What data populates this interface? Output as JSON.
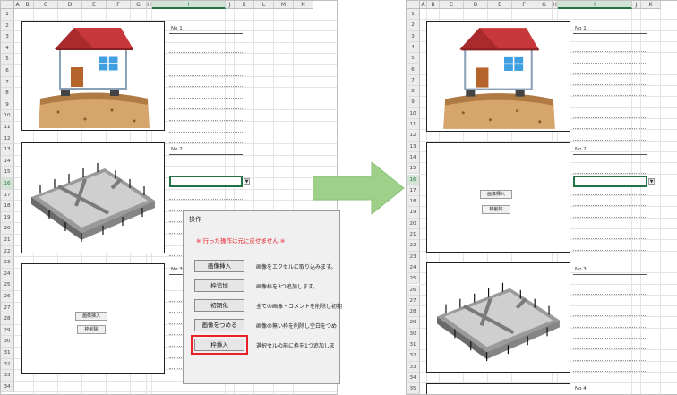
{
  "columns_left": [
    "A",
    "B",
    "C",
    "D",
    "E",
    "F",
    "G",
    "H",
    "I",
    "J",
    "K",
    "L",
    "M",
    "N"
  ],
  "columns_right": [
    "A",
    "B",
    "C",
    "D",
    "E",
    "F",
    "G",
    "H",
    "I",
    "J",
    "K"
  ],
  "rows_left": [
    "1",
    "2",
    "3",
    "4",
    "5",
    "6",
    "7",
    "8",
    "9",
    "10",
    "11",
    "12",
    "13",
    "14",
    "15",
    "16",
    "17",
    "18",
    "19",
    "20",
    "21",
    "22",
    "23",
    "24",
    "25",
    "26",
    "27",
    "28",
    "29",
    "30",
    "31",
    "32",
    "33",
    "34"
  ],
  "rows_right": [
    "1",
    "2",
    "3",
    "4",
    "5",
    "6",
    "7",
    "8",
    "9",
    "10",
    "11",
    "12",
    "13",
    "14",
    "15",
    "16",
    "17",
    "18",
    "19",
    "20",
    "21",
    "22",
    "23",
    "24",
    "25",
    "26",
    "27",
    "28",
    "29",
    "30",
    "31",
    "32",
    "33",
    "34",
    "35"
  ],
  "left": {
    "labels": [
      "No 1",
      "No 2",
      "No 3"
    ],
    "frame3_buttons": [
      "画像挿入",
      "枠削除"
    ]
  },
  "right": {
    "labels": [
      "No 1",
      "No 2",
      "No 3",
      "No 4"
    ],
    "frame2_buttons": [
      "画像挿入",
      "枠削除"
    ]
  },
  "dropdown_symbol": "▼",
  "dialog": {
    "title": "操作",
    "warning": "※ 行った操作は元に戻せません ※",
    "buttons": [
      {
        "label": "画像挿入",
        "desc": "画像をエクセルに取り込みます。"
      },
      {
        "label": "枠追加",
        "desc": "画像枠を3つ追加します。"
      },
      {
        "label": "初期化",
        "desc": "全ての画像・コメントを削除し初期"
      },
      {
        "label": "画像をつめる",
        "desc": "画像の無い枠を削除し空白をつめ"
      },
      {
        "label": "枠挿入",
        "desc": "選択セルの前に枠を1つ追加しま"
      }
    ]
  },
  "colors": {
    "header": "#ececec",
    "selected": "#217346",
    "warning": "#e8202a",
    "highlight": "#e8202a",
    "arrow": "#9fd08a"
  }
}
